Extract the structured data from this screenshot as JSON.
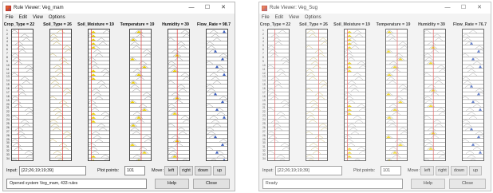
{
  "windows": [
    {
      "title": "Rule Viewer: Veg_mam",
      "menu": [
        "File",
        "Edit",
        "View",
        "Options"
      ],
      "variables": [
        "Crop_Type = 22",
        "Soil_Type = 26",
        "Soil_Moisture = 19",
        "Temperature = 19",
        "Humidity = 39",
        "Flow_Rate = 98.7"
      ],
      "input_label": "Input:",
      "input_value": "[22;26;19;19;39]",
      "plot_points_label": "Plot points:",
      "plot_points_value": "101",
      "move_label": "Move:",
      "buttons": [
        "left",
        "right",
        "down",
        "up"
      ],
      "status": "Opened system Veg_mam, 433 rules",
      "help_label": "Help",
      "close_label": "Close"
    },
    {
      "title": "Rule Viewer: Veg_Sug",
      "menu": [
        "File",
        "Edit",
        "View",
        "Options"
      ],
      "variables": [
        "Crop_Type = 22",
        "Soil_Type = 26",
        "Soil_Moisture = 19",
        "Temperature = 19",
        "Humidity = 39",
        "Flow_Rate = 76.7"
      ],
      "input_label": "Input:",
      "input_value": "[22;26;19;19;39]",
      "plot_points_label": "Plot points:",
      "plot_points_value": "101",
      "move_label": "Move:",
      "buttons": [
        "left",
        "right",
        "down",
        "up"
      ],
      "status": "Ready",
      "help_label": "Help",
      "close_label": "Close"
    }
  ],
  "rule_rows_visible": 34,
  "colors": {
    "window_bg": "#f0f0f0",
    "red_line": "#e04040",
    "fill_yellow": "#f0d000",
    "output_fill_blue": "#3a5ec0",
    "mf_curve_gray": "#9a9a9a",
    "tan_curve": "#c8b35a"
  },
  "window_controls": {
    "minimize_icon": "—",
    "maximize_icon": "☐",
    "close_icon": "✕"
  }
}
